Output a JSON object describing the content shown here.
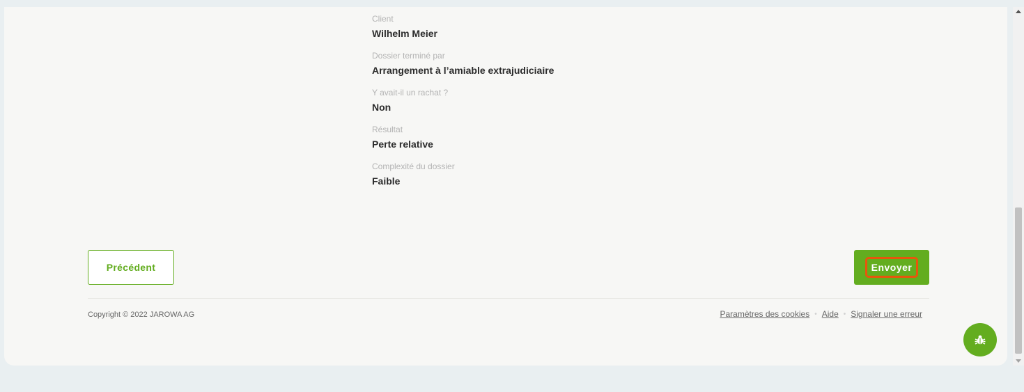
{
  "summary": {
    "fields": [
      {
        "label": "Client",
        "value": "Wilhelm Meier"
      },
      {
        "label": "Dossier terminé par",
        "value": "Arrangement à l’amiable extrajudiciaire"
      },
      {
        "label": "Y avait-il un rachat ?",
        "value": "Non"
      },
      {
        "label": "Résultat",
        "value": "Perte relative"
      },
      {
        "label": "Complexité du dossier",
        "value": "Faible"
      }
    ]
  },
  "actions": {
    "previous_label": "Précédent",
    "send_label": "Envoyer"
  },
  "footer": {
    "copyright": "Copyright © 2022 JAROWA AG",
    "links": {
      "cookies": "Paramètres des cookies",
      "help": "Aide",
      "report": "Signaler une erreur"
    },
    "separator": "•"
  },
  "icons": {
    "bug": "bug-icon",
    "scroll_up": "arrow-up-icon",
    "scroll_down": "arrow-down-icon"
  },
  "colors": {
    "accent": "#63ad1f",
    "highlight": "#e8560c",
    "page_bg": "#e9eff1",
    "card_bg": "#f7f7f5"
  }
}
